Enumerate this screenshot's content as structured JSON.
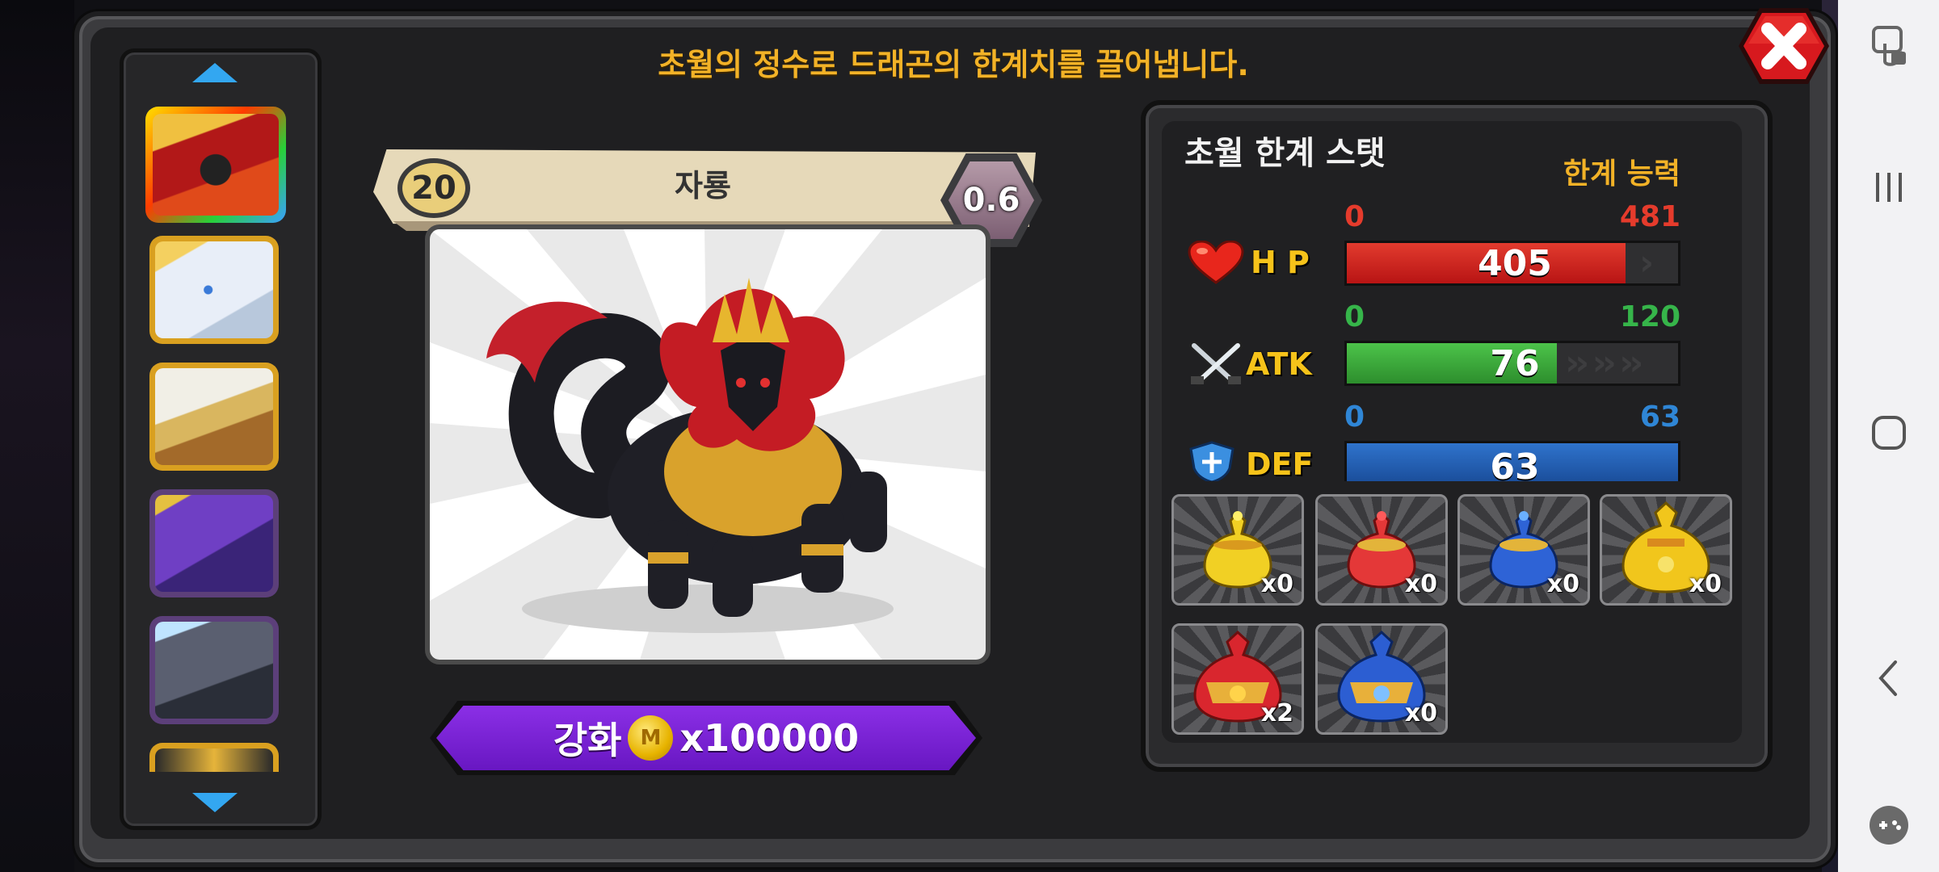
{
  "header": {
    "title": "초월의 정수로 드래곤의 한계치를 끌어냅니다."
  },
  "dragon": {
    "level": "20",
    "name": "자룡",
    "grade": "0.6"
  },
  "upgrade_button": {
    "label": "강화",
    "coin_letter": "M",
    "cost": "x100000"
  },
  "stats": {
    "title": "초월 한계 스탯",
    "limit_label": "한계 능력",
    "hp": {
      "name": "H P",
      "min": "0",
      "max": "481",
      "value": "405",
      "fill": 0.842
    },
    "atk": {
      "name": "ATK",
      "min": "0",
      "max": "120",
      "value": "76",
      "fill": 0.633
    },
    "def": {
      "name": "DEF",
      "min": "0",
      "max": "63",
      "value": "63",
      "fill": 1.0
    }
  },
  "items": [
    {
      "count": "x0",
      "kind": "yellow-essence-small"
    },
    {
      "count": "x0",
      "kind": "red-essence-small"
    },
    {
      "count": "x0",
      "kind": "blue-essence-small"
    },
    {
      "count": "x0",
      "kind": "yellow-essence-large"
    },
    {
      "count": "x2",
      "kind": "red-essence-large"
    },
    {
      "count": "x0",
      "kind": "blue-essence-large"
    }
  ],
  "colors": {
    "title_gold": "#f2b227",
    "hp_red": "#c81e1e",
    "atk_green": "#36a336",
    "def_blue": "#1f5fb2",
    "hp_label_red": "#e53b2c",
    "atk_label_green": "#36b54a",
    "def_label_blue": "#2f86d6",
    "upgrade_purple": "#7a22d6"
  }
}
